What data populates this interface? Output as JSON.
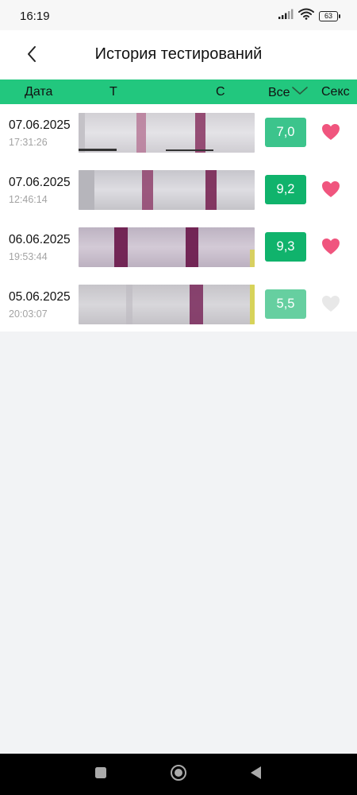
{
  "status_bar": {
    "time": "16:19",
    "battery": "63"
  },
  "header": {
    "title": "История тестирований",
    "back_icon": "chevron-left-icon"
  },
  "table_head": {
    "date": "Дата",
    "t": "T",
    "c": "C",
    "filter": "Все",
    "filter_icon": "chevron-down-icon",
    "sex": "Секс"
  },
  "colors": {
    "accent": "#22c77e",
    "heart_active": "#f0557e",
    "heart_inactive": "#e8e8e8"
  },
  "rows": [
    {
      "date": "07.06.2025",
      "time": "17:31:26",
      "score": "7,0",
      "score_color": "#3cc48c",
      "sex": true
    },
    {
      "date": "07.06.2025",
      "time": "12:46:14",
      "score": "9,2",
      "score_color": "#10b36c",
      "sex": true
    },
    {
      "date": "06.06.2025",
      "time": "19:53:44",
      "score": "9,3",
      "score_color": "#10b36c",
      "sex": true
    },
    {
      "date": "05.06.2025",
      "time": "20:03:07",
      "score": "5,5",
      "score_color": "#66cfa0",
      "sex": false
    }
  ]
}
